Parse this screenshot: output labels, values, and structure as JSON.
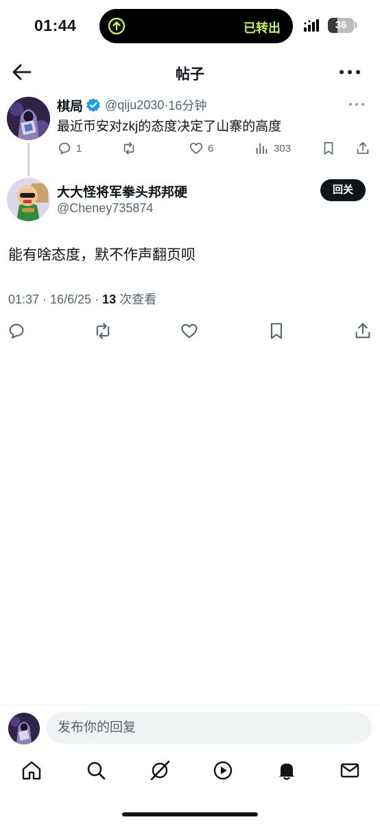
{
  "status_bar": {
    "time": "01:44",
    "island_text": "已转出",
    "island_accent": "#c6f25a",
    "battery": {
      "level_percent": 36,
      "text": "36"
    }
  },
  "header": {
    "title": "帖子",
    "back_icon": "arrow-left-icon",
    "more_icon": "more-horizontal-icon"
  },
  "parent_tweet": {
    "display_name": "棋局",
    "verified": true,
    "handle": "@qiju2030",
    "separator": " · ",
    "time_ago": "16分钟",
    "text": "最近币安对zkj的态度决定了山寨的高度",
    "stats": {
      "replies": "1",
      "reposts": "",
      "likes": "6",
      "views": "303"
    }
  },
  "reply_tweet": {
    "display_name": "大大怪将军拳头邦邦硬",
    "handle": "@Cheney735874",
    "follow_label": "回关",
    "text": "能有啥态度，默不作声翻页呗",
    "meta": {
      "time": "01:37",
      "sep1": " · ",
      "date": "16/6/25",
      "sep2": " · ",
      "views_count": "13",
      "views_label": " 次查看"
    }
  },
  "compose": {
    "placeholder": "发布你的回复"
  },
  "tabbar": {
    "items": [
      "home-icon",
      "search-icon",
      "grok-icon",
      "video-icon",
      "notifications-icon",
      "messages-icon"
    ]
  },
  "colors": {
    "text_primary": "#0f1419",
    "text_secondary": "#536471",
    "verified_blue": "#1d9bf0",
    "divider": "#eff3f4"
  }
}
